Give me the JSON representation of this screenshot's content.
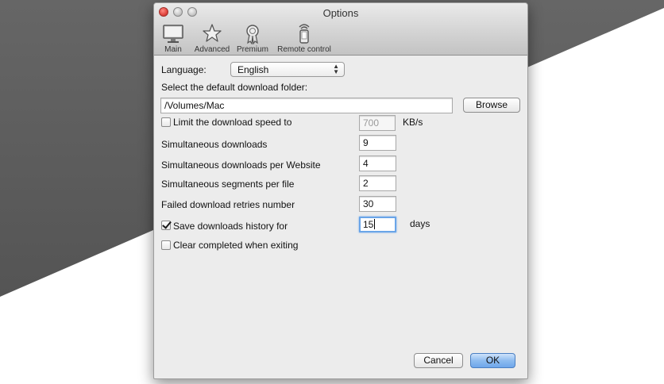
{
  "window": {
    "title": "Options"
  },
  "toolbar": {
    "items": [
      {
        "label": "Main",
        "icon": "monitor-icon"
      },
      {
        "label": "Advanced",
        "icon": "star-icon"
      },
      {
        "label": "Premium",
        "icon": "award-ribbon-icon"
      },
      {
        "label": "Remote control",
        "icon": "remote-phone-icon"
      }
    ]
  },
  "language": {
    "label": "Language:",
    "value": "English"
  },
  "folder": {
    "label": "Select the default download folder:",
    "value": "/Volumes/Mac",
    "browse_label": "Browse"
  },
  "speed": {
    "label": "Limit the download speed to",
    "checked": false,
    "value": "700",
    "unit": "KB/s"
  },
  "simultaneous_downloads": {
    "label": "Simultaneous downloads",
    "value": "9"
  },
  "per_website": {
    "label": "Simultaneous downloads per Website",
    "value": "4"
  },
  "segments": {
    "label": "Simultaneous segments per file",
    "value": "2"
  },
  "retries": {
    "label": "Failed download retries number",
    "value": "30"
  },
  "history": {
    "label": "Save downloads history for",
    "checked": true,
    "value": "15",
    "unit": "days"
  },
  "clear": {
    "label": "Clear completed when exiting",
    "checked": false
  },
  "buttons": {
    "cancel": "Cancel",
    "ok": "OK"
  },
  "colors": {
    "accent": "#6ea6ea",
    "focus_ring": "#6aa5e8"
  }
}
